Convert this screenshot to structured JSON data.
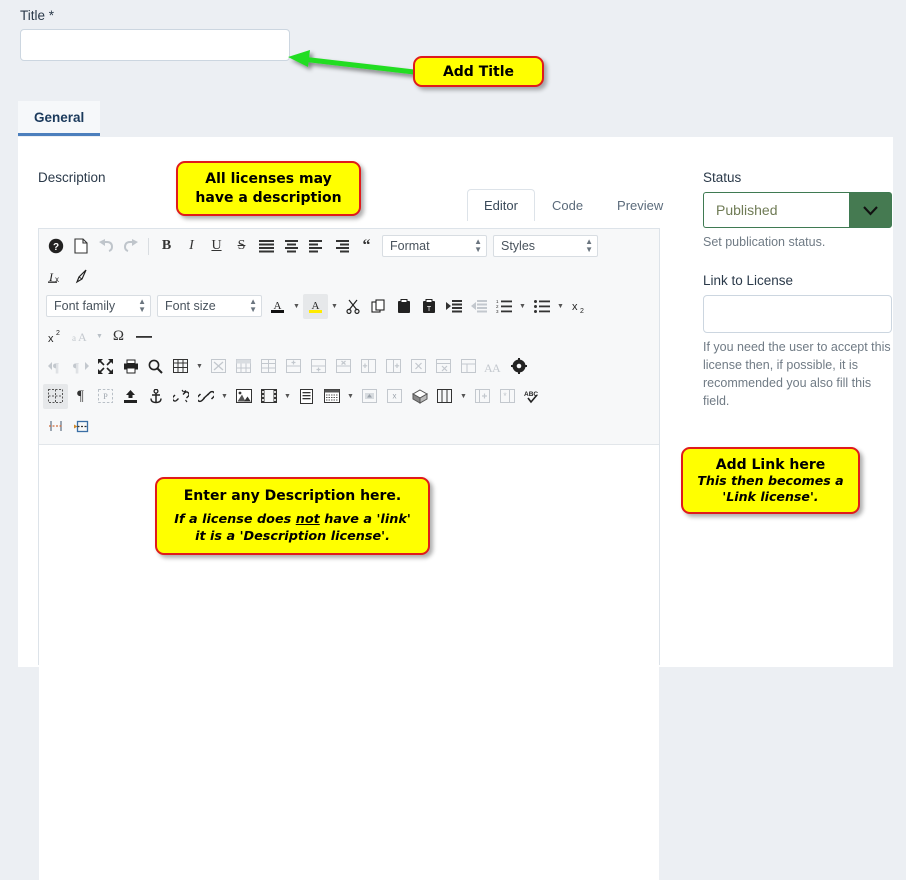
{
  "form": {
    "title_label": "Title *",
    "title_value": "",
    "title_placeholder": ""
  },
  "tabs": [
    {
      "label": "General",
      "active": true
    }
  ],
  "description": {
    "label": "Description",
    "editor_tabs": [
      {
        "label": "Editor",
        "active": true
      },
      {
        "label": "Code",
        "active": false
      },
      {
        "label": "Preview",
        "active": false
      }
    ],
    "selects": {
      "format": "Format",
      "styles": "Styles",
      "font_family": "Font family",
      "font_size": "Font size"
    },
    "content": ""
  },
  "sidebar": {
    "status_label": "Status",
    "status_value": "Published",
    "status_help": "Set publication status.",
    "link_label": "Link to License",
    "link_value": "",
    "link_help": "If you need the user to accept this license then, if possible, it is recommended you also fill this field."
  },
  "callouts": {
    "add_title": "Add Title",
    "description_line1": "All licenses may",
    "description_line2": "have a description",
    "enter_line1": "Enter any Description here.",
    "enter_line2_a": "If a license does ",
    "enter_line2_not": "not",
    "enter_line2_b": " have a 'link'",
    "enter_line3": "it is a 'Description license'.",
    "link_line1": "Add Link here",
    "link_line2": "This then becomes a",
    "link_line3": "'Link license'."
  },
  "colors": {
    "callout_fill": "#ffff00",
    "callout_border": "#e01b1b",
    "arrow": "#22dd22",
    "status_accent": "#457a51",
    "tab_underline": "#4c7fbd",
    "page_background": "#eceff3"
  },
  "toolbar": {
    "row1": [
      "help-icon",
      "new-document-icon",
      "undo-icon",
      "redo-icon",
      "separator",
      "bold-icon",
      "italic-icon",
      "underline-icon",
      "strikethrough-icon",
      "align-justify-icon",
      "align-center-icon"
    ],
    "row1b": [
      "align-left-icon",
      "align-right-icon",
      "blockquote-icon",
      "format-select",
      "styles-select"
    ],
    "row2": [
      "remove-format-icon",
      "paint-format-icon"
    ],
    "row3": [
      "font-family-select",
      "font-size-select",
      "text-color-icon",
      "text-color-caret",
      "background-color-icon",
      "background-color-caret",
      "cut-icon",
      "copy-icon",
      "paste-icon",
      "paste-text-icon",
      "indent-icon",
      "outdent-icon",
      "numbered-list-icon",
      "numbered-list-caret",
      "bullet-list-icon",
      "bullet-list-caret",
      "subscript-icon"
    ],
    "row4": [
      "superscript-icon",
      "change-case-icon",
      "change-case-caret",
      "special-character-icon",
      "horizontal-rule-icon"
    ],
    "row5": [
      "ltr-icon",
      "rtl-icon",
      "fullscreen-icon",
      "print-icon",
      "search-icon",
      "table-icon",
      "table-caret",
      "delete-table-icon",
      "table-header-icon",
      "table-row-icon",
      "insert-row-above-icon",
      "insert-row-below-icon",
      "insert-column-icon",
      "delete-row-icon",
      "merge-cell-icon",
      "split-cell-icon",
      "delete-column-icon",
      "cell-properties-icon",
      "table-style-icon",
      "table-settings-icon"
    ],
    "row6": [
      "show-blocks-icon",
      "paragraph-icon",
      "placeholder-icon",
      "upload-icon",
      "anchor-icon",
      "unlink-icon",
      "link-icon",
      "link-caret",
      "image-icon",
      "media-icon",
      "media-caret",
      "page-break-icon",
      "template-icon",
      "code-block-icon",
      "layers-icon",
      "columns-icon",
      "columns-caret",
      "insert-before-icon",
      "insert-after-icon",
      "spellcheck-icon"
    ],
    "row7": [
      "table-resize-icon",
      "frame-icon"
    ]
  }
}
